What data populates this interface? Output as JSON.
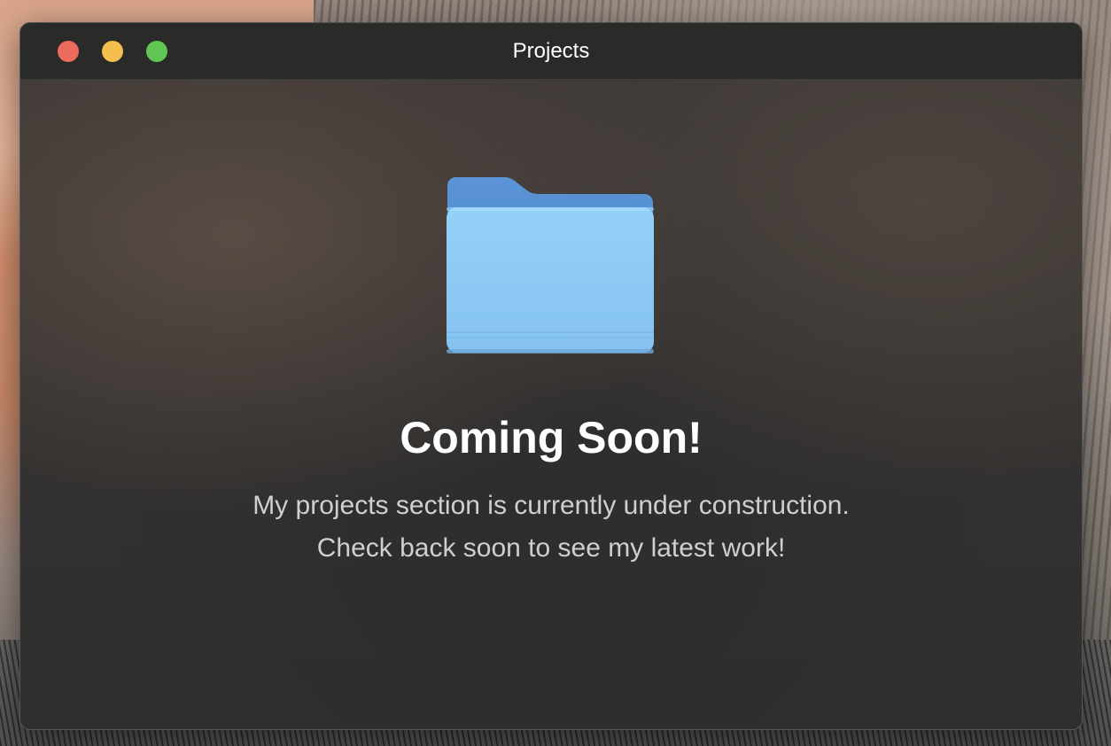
{
  "window": {
    "title": "Projects"
  },
  "content": {
    "icon": "folder-icon",
    "heading": "Coming Soon!",
    "description_line1": "My projects section is currently under construction.",
    "description_line2": "Check back soon to see my latest work!"
  },
  "colors": {
    "close": "#ec6a5e",
    "minimize": "#f4bf4f",
    "maximize": "#61c554",
    "folder": "#8fcdf6"
  }
}
